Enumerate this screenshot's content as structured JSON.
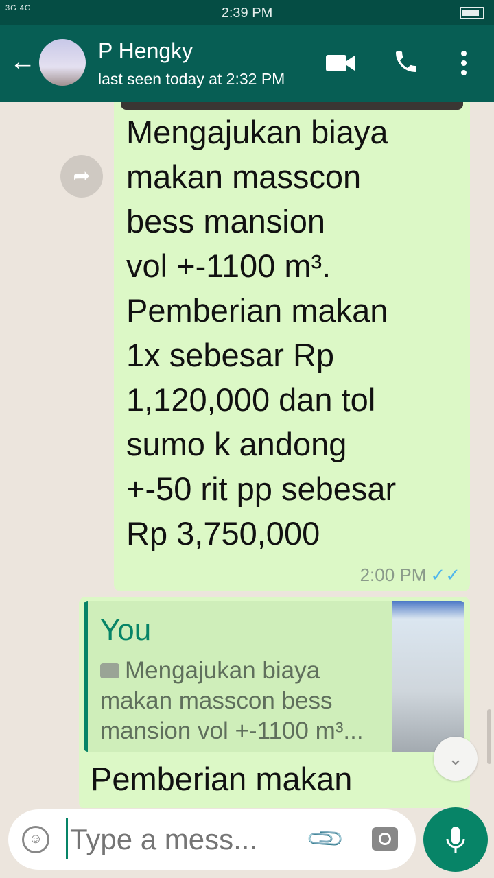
{
  "status_bar": {
    "time": "2:39 PM",
    "signal": "3G 4G"
  },
  "header": {
    "contact_name": "P Hengky",
    "last_seen": "last seen today at 2:32 PM"
  },
  "messages": [
    {
      "text": "Mengajukan biaya\nmakan masscon\nbess mansion\nvol +-1100 m³.\nPemberian makan\n1x sebesar Rp\n1,120,000 dan tol\nsumo k andong\n+-50 rit pp sebesar\nRp 3,750,000",
      "time": "2:00 PM",
      "status_icon": "double-check"
    },
    {
      "quote_author": "You",
      "quote_text": "Mengajukan biaya makan masscon bess mansion vol +-1100 m³...",
      "text": "Pemberian makan"
    }
  ],
  "input": {
    "placeholder": "Type a mess..."
  },
  "colors": {
    "header": "#075e54",
    "status_bar": "#054d44",
    "bubble": "#dcf8c6",
    "accent": "#078467"
  }
}
